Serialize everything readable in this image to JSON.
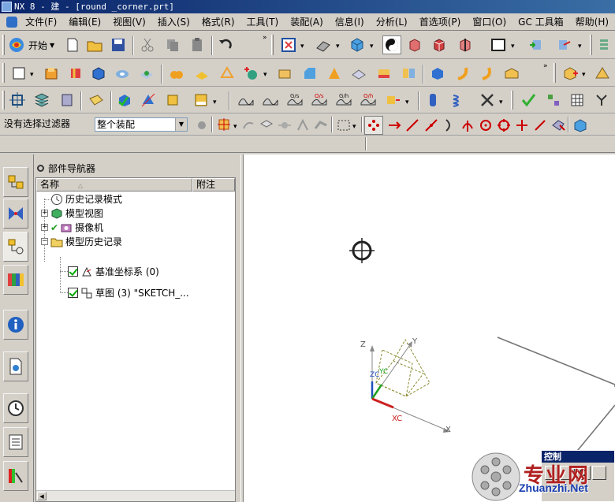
{
  "window": {
    "title": "NX 8 - 建 - [round _corner.prt]"
  },
  "menu": [
    {
      "id": "file",
      "label": "文件(F)"
    },
    {
      "id": "edit",
      "label": "编辑(E)"
    },
    {
      "id": "view",
      "label": "视图(V)"
    },
    {
      "id": "insert",
      "label": "插入(S)"
    },
    {
      "id": "format",
      "label": "格式(R)"
    },
    {
      "id": "tools",
      "label": "工具(T)"
    },
    {
      "id": "assemblies",
      "label": "装配(A)"
    },
    {
      "id": "info",
      "label": "信息(I)"
    },
    {
      "id": "analysis",
      "label": "分析(L)"
    },
    {
      "id": "preferences",
      "label": "首选项(P)"
    },
    {
      "id": "window",
      "label": "窗口(O)"
    },
    {
      "id": "gc",
      "label": "GC 工具箱"
    },
    {
      "id": "help",
      "label": "帮助(H)"
    }
  ],
  "toolbar": {
    "start_label": "开始"
  },
  "selection": {
    "filter_value": "没有选择过滤器",
    "scope_value": "整个装配"
  },
  "navigator": {
    "title": "部件导航器",
    "columns": [
      "名称",
      "附注"
    ],
    "nodes": {
      "history_mode": "历史记录模式",
      "model_views": "模型视图",
      "cameras": "摄像机",
      "model_history": "模型历史记录",
      "datum_csys": "基准坐标系 (0)",
      "sketch": "草图 (3) \"SKETCH_..."
    }
  },
  "viewport": {
    "axes": {
      "z": "Z",
      "y": "Y",
      "zc": "ZC",
      "yc": "YC",
      "xc": "XC",
      "x": "X"
    }
  },
  "control_panel": {
    "title": "控制"
  },
  "watermark": {
    "text": "专业网",
    "url": "Zhuanzhi.Net"
  },
  "colors": {
    "accent": "#0a246a",
    "chrome": "#d4d0c8",
    "xc_axis": "#cc2020",
    "zc_axis": "#2050c0",
    "yc_axis": "#20a020"
  }
}
